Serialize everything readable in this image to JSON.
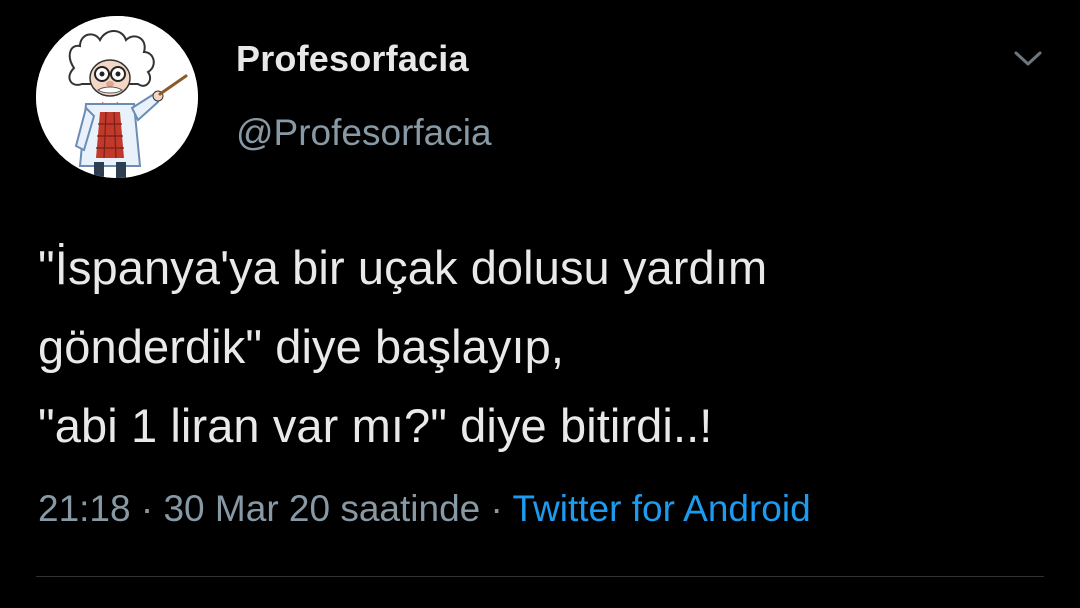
{
  "user": {
    "display_name": "Profesorfacia",
    "handle": "@Profesorfacia",
    "avatar_icon": "professor-cartoon-avatar"
  },
  "tweet": {
    "lines": [
      "\"İspanya'ya bir uçak dolusu yardım",
      "gönderdik\" diye başlayıp,",
      "\"abi 1 liran var mı?\" diye bitirdi..!"
    ]
  },
  "meta": {
    "time": "21:18",
    "separator": "·",
    "date": "30 Mar 20 saatinde",
    "source": "Twitter for Android"
  },
  "icons": {
    "caret": "chevron-down-icon"
  },
  "colors": {
    "background": "#000000",
    "text": "#e9e9e9",
    "secondary": "#8899a6",
    "link": "#1d9bf0"
  }
}
